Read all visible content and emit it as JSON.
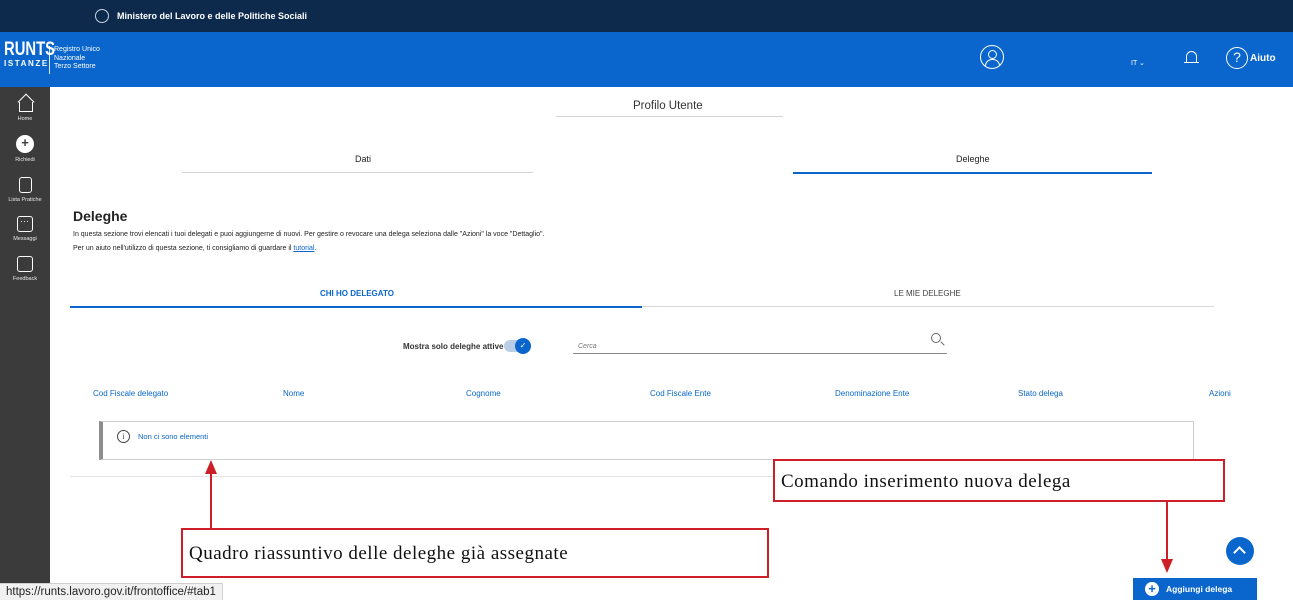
{
  "ministry_bar": {
    "text": "Ministero del Lavoro e delle Politiche Sociali"
  },
  "header": {
    "logo_main": "RUNTS",
    "logo_sub": "ISTANZE",
    "logo_desc": [
      "Registro Unico",
      "Nazionale",
      "Terzo Settore"
    ],
    "language": "IT ⌄",
    "help_label": "Aiuto",
    "help_glyph": "?"
  },
  "sidebar": {
    "items": [
      {
        "label": "Home",
        "icon": "home-icon"
      },
      {
        "label": "Richiedi",
        "icon": "plus-circle-icon"
      },
      {
        "label": "Lista Pratiche",
        "icon": "document-icon"
      },
      {
        "label": "Messaggi",
        "icon": "message-icon"
      },
      {
        "label": "Feedback",
        "icon": "feedback-icon"
      }
    ]
  },
  "profile": {
    "title": "Profilo Utente",
    "tabs": [
      {
        "label": "Dati"
      },
      {
        "label": "Deleghe"
      }
    ],
    "active_tab": "Deleghe"
  },
  "deleghe": {
    "title": "Deleghe",
    "description": "In questa sezione trovi elencati i tuoi delegati e puoi aggiungerne di nuovi. Per gestire o revocare una delega seleziona dalle \"Azioni\" la voce \"Dettaglio\".",
    "help_text": "Per un aiuto nell'utilizzo di questa sezione, ti consigliamo di guardare il",
    "help_link": "tutorial",
    "help_suffix": ".",
    "sub_tabs": [
      {
        "label": "CHI HO DELEGATO"
      },
      {
        "label": "LE MIE DELEGHE"
      }
    ],
    "active_sub_tab": "CHI HO DELEGATO",
    "filter_toggle_label": "Mostra solo deleghe attive",
    "filter_toggle_checked": true,
    "toggle_check": "✓",
    "search_placeholder": "Cerca",
    "search_value": "",
    "columns": [
      "Cod Fiscale delegato",
      "Nome",
      "Cognome",
      "Cod Fiscale Ente",
      "Denominazione Ente",
      "Stato delega",
      "Azioni"
    ],
    "info_glyph": "i",
    "empty_message": "Non ci sono elementi",
    "add_button_label": "Aggiungi delega",
    "add_button_glyph": "+"
  },
  "annotations": {
    "new_delegation_command": "Comando inserimento nuova delega",
    "summary_panel": "Quadro riassuntivo delle deleghe già assegnate"
  },
  "status_bar": {
    "url": "https://runts.lavoro.gov.it/frontoffice/#tab1"
  },
  "colors": {
    "ministry_bar": "#0d2a4c",
    "header_blue": "#0a66cc",
    "sidebar": "#3b3b3b",
    "annotation_red": "#cc1f27"
  }
}
